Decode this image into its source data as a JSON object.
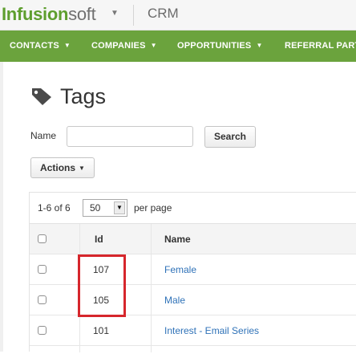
{
  "header": {
    "logo_part1": "Infusion",
    "logo_part2": "soft",
    "logo_menu_icon": "chevron-down-icon",
    "app_name": "CRM"
  },
  "nav": {
    "items": [
      {
        "label": "CONTACTS"
      },
      {
        "label": "COMPANIES"
      },
      {
        "label": "OPPORTUNITIES"
      },
      {
        "label": "REFERRAL PART"
      }
    ],
    "caret": "▼"
  },
  "page": {
    "title": "Tags",
    "title_icon": "tag-icon"
  },
  "filter": {
    "name_label": "Name",
    "name_value": "",
    "search_label": "Search",
    "actions_label": "Actions",
    "actions_caret": "▼"
  },
  "pager": {
    "range": "1-6 of 6",
    "per_page_value": "50",
    "per_page_label": "per page"
  },
  "table": {
    "columns": [
      "Id",
      "Name"
    ],
    "rows": [
      {
        "id": "107",
        "name": "Female"
      },
      {
        "id": "105",
        "name": "Male"
      },
      {
        "id": "101",
        "name": "Interest - Email Series"
      }
    ]
  },
  "colors": {
    "nav_green": "#6ba33d",
    "logo_green": "#5e9e2e",
    "link_blue": "#2f72b8",
    "highlight_red": "#d6262c"
  }
}
